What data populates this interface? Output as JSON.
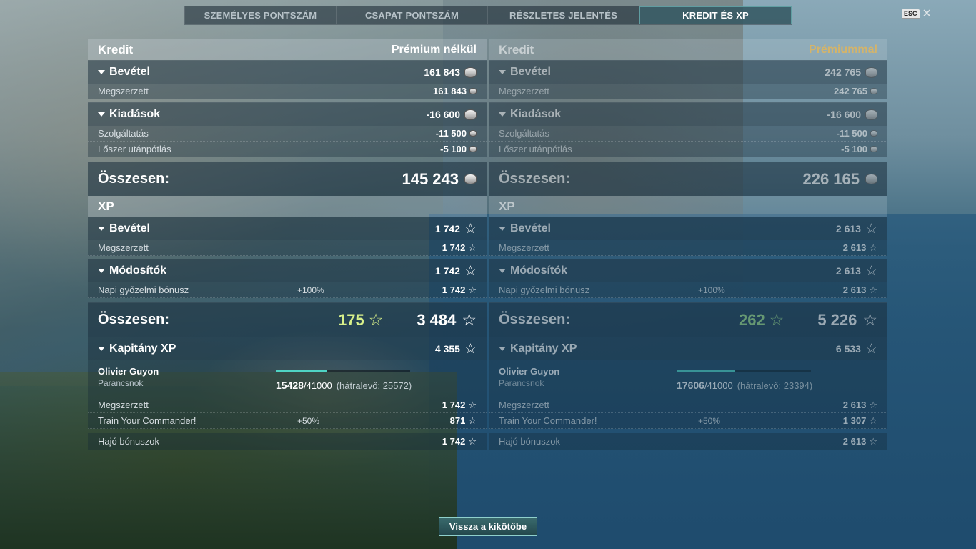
{
  "tabs": [
    "SZEMÉLYES PONTSZÁM",
    "CSAPAT PONTSZÁM",
    "RÉSZLETES JELENTÉS",
    "KREDIT ÉS XP"
  ],
  "active_tab": 3,
  "esc": {
    "key": "ESC",
    "close": "✕"
  },
  "panels": {
    "left": {
      "credit_title": "Kredit",
      "mode": "Prémium nélkül",
      "income": {
        "label": "Bevétel",
        "value": "161 843",
        "rows": [
          {
            "label": "Megszerzett",
            "value": "161 843"
          }
        ]
      },
      "expenses": {
        "label": "Kiadások",
        "value": "-16 600",
        "rows": [
          {
            "label": "Szolgáltatás",
            "value": "-11 500"
          },
          {
            "label": "Lőszer utánpótlás",
            "value": "-5 100"
          }
        ]
      },
      "credit_total": {
        "label": "Összesen:",
        "value": "145 243"
      },
      "xp_title": "XP",
      "xp_income": {
        "label": "Bevétel",
        "value": "1 742",
        "rows": [
          {
            "label": "Megszerzett",
            "value": "1 742"
          }
        ]
      },
      "modifiers": {
        "label": "Módosítók",
        "value": "1 742",
        "rows": [
          {
            "label": "Napi győzelmi bónusz",
            "mid": "+100%",
            "value": "1 742"
          }
        ]
      },
      "xp_total": {
        "label": "Összesen:",
        "bonus": "175",
        "value": "3 484"
      },
      "captain": {
        "label": "Kapitány XP",
        "value": "4 355",
        "name": "Olivier Guyon",
        "rank": "Parancsnok",
        "xp_current": "15428",
        "xp_max": "/41000",
        "remaining": "(hátralevő: 25572)",
        "progress": 0.376,
        "rows": [
          {
            "label": "Megszerzett",
            "value": "1 742"
          },
          {
            "label": "Train Your Commander!",
            "mid": "+50%",
            "value": "871"
          }
        ],
        "ship_bonus": {
          "label": "Hajó bónuszok",
          "value": "1 742"
        }
      }
    },
    "right": {
      "credit_title": "Kredit",
      "mode": "Prémiummal",
      "income": {
        "label": "Bevétel",
        "value": "242 765",
        "rows": [
          {
            "label": "Megszerzett",
            "value": "242 765"
          }
        ]
      },
      "expenses": {
        "label": "Kiadások",
        "value": "-16 600",
        "rows": [
          {
            "label": "Szolgáltatás",
            "value": "-11 500"
          },
          {
            "label": "Lőszer utánpótlás",
            "value": "-5 100"
          }
        ]
      },
      "credit_total": {
        "label": "Összesen:",
        "value": "226 165"
      },
      "xp_title": "XP",
      "xp_income": {
        "label": "Bevétel",
        "value": "2 613",
        "rows": [
          {
            "label": "Megszerzett",
            "value": "2 613"
          }
        ]
      },
      "modifiers": {
        "label": "Módosítók",
        "value": "2 613",
        "rows": [
          {
            "label": "Napi győzelmi bónusz",
            "mid": "+100%",
            "value": "2 613"
          }
        ]
      },
      "xp_total": {
        "label": "Összesen:",
        "bonus": "262",
        "value": "5 226"
      },
      "captain": {
        "label": "Kapitány XP",
        "value": "6 533",
        "name": "Olivier Guyon",
        "rank": "Parancsnok",
        "xp_current": "17606",
        "xp_max": "/41000",
        "remaining": "(hátralevő: 23394)",
        "progress": 0.429,
        "rows": [
          {
            "label": "Megszerzett",
            "value": "2 613"
          },
          {
            "label": "Train Your Commander!",
            "mid": "+50%",
            "value": "1 307"
          }
        ],
        "ship_bonus": {
          "label": "Hajó bónuszok",
          "value": "2 613"
        }
      }
    }
  },
  "back_button": "Vissza a kikötőbe",
  "icons": {
    "credit": "silver-coin-icon",
    "xp": "star-icon"
  }
}
